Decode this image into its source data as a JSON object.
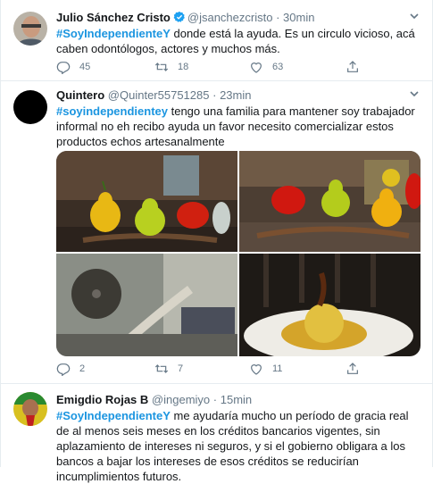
{
  "tweets": [
    {
      "name": "Julio Sánchez Cristo",
      "handle": "@jsanchezcristo",
      "dot": "·",
      "time": "30min",
      "hashtag": "#SoyIndependienteY",
      "text": " donde está la ayuda. Es un circulo vicioso, acá caben odontólogos, actores y muchos más.",
      "replies": "45",
      "retweets": "18",
      "likes": "63"
    },
    {
      "name": "Quintero",
      "handle": "@Quinter55751285",
      "dot": "·",
      "time": "23min",
      "hashtag": "#soyindependientey",
      "text": " tengo una familia para mantener soy trabajador informal no eh recibo ayuda  un favor necesito comercializar estos productos echos artesanalmente",
      "replies": "2",
      "retweets": "7",
      "likes": "11"
    },
    {
      "name": "Emigdio Rojas B",
      "handle": "@ingemiyo",
      "dot": "·",
      "time": "15min",
      "hashtag": "#SoyIndependienteY",
      "text": " me ayudaría mucho un período de gracia real de al menos seis meses en los créditos bancarios vigentes, sin aplazamiento de intereses ni seguros, y si el gobierno obligara a los bancos a bajar los intereses de esos créditos se reducirían incumplimientos futuros."
    }
  ],
  "icons": {
    "reply": "reply-icon",
    "retweet": "retweet-icon",
    "like": "heart-icon",
    "share": "share-icon",
    "caret": "chevron-down-icon",
    "verified": "verified-badge-icon"
  },
  "colors": {
    "link": "#1b95e0",
    "secondary_text": "#657786",
    "divider": "#e6ecf0",
    "verified": "#1da1f2"
  }
}
